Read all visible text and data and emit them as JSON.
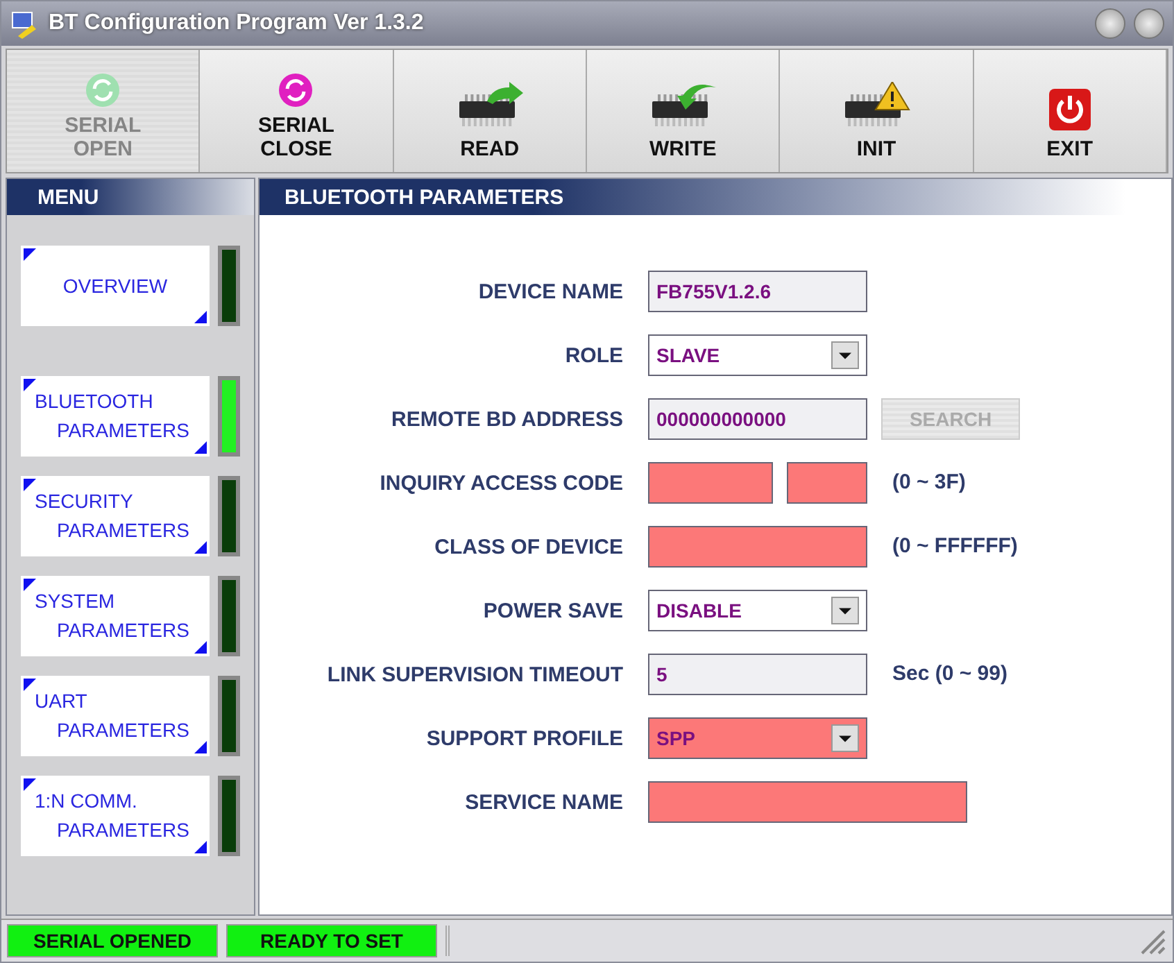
{
  "window": {
    "title": "BT Configuration Program Ver 1.3.2"
  },
  "toolbar": [
    {
      "label": "SERIAL OPEN",
      "kind": "serial-open",
      "disabled": true
    },
    {
      "label": "SERIAL CLOSE",
      "kind": "serial-close",
      "disabled": false
    },
    {
      "label": "READ",
      "kind": "read",
      "disabled": false
    },
    {
      "label": "WRITE",
      "kind": "write",
      "disabled": false
    },
    {
      "label": "INIT",
      "kind": "init",
      "disabled": false
    },
    {
      "label": "EXIT",
      "kind": "exit",
      "disabled": false
    }
  ],
  "menu": {
    "title": "MENU",
    "items": [
      {
        "lines": [
          "OVERVIEW"
        ],
        "selected": false
      },
      {
        "lines": [
          "BLUETOOTH",
          "PARAMETERS"
        ],
        "selected": true
      },
      {
        "lines": [
          "SECURITY",
          "PARAMETERS"
        ],
        "selected": false
      },
      {
        "lines": [
          "SYSTEM",
          "PARAMETERS"
        ],
        "selected": false
      },
      {
        "lines": [
          "UART",
          "PARAMETERS"
        ],
        "selected": false
      },
      {
        "lines": [
          "1:N COMM.",
          "PARAMETERS"
        ],
        "selected": false
      }
    ]
  },
  "panel": {
    "title": "BLUETOOTH PARAMETERS",
    "rows": [
      {
        "label": "DEVICE NAME",
        "kind": "text",
        "value": "FB755V1.2.6",
        "invalid": false
      },
      {
        "label": "ROLE",
        "kind": "select",
        "value": "SLAVE",
        "invalid": false
      },
      {
        "label": "REMOTE BD ADDRESS",
        "kind": "text",
        "value": "000000000000",
        "invalid": false,
        "button": {
          "label": "SEARCH",
          "disabled": true
        }
      },
      {
        "label": "INQUIRY ACCESS CODE",
        "kind": "split",
        "parts": [
          {
            "invalid": true
          },
          {
            "invalid": true
          }
        ],
        "hint": "(0 ~ 3F)"
      },
      {
        "label": "CLASS OF DEVICE",
        "kind": "text",
        "invalid": true,
        "hint": "(0 ~ FFFFFF)"
      },
      {
        "label": "POWER SAVE",
        "kind": "select",
        "value": "DISABLE",
        "invalid": false
      },
      {
        "label": "LINK SUPERVISION TIMEOUT",
        "kind": "text",
        "value": "5",
        "invalid": false,
        "hint": "Sec (0 ~ 99)"
      },
      {
        "label": "SUPPORT PROFILE",
        "kind": "select",
        "value": "SPP",
        "invalid": true
      },
      {
        "label": "SERVICE NAME",
        "kind": "wide",
        "invalid": true
      }
    ]
  },
  "status_bar": [
    {
      "text": "SERIAL OPENED",
      "active": true
    },
    {
      "text": "READY TO SET",
      "active": true
    }
  ]
}
